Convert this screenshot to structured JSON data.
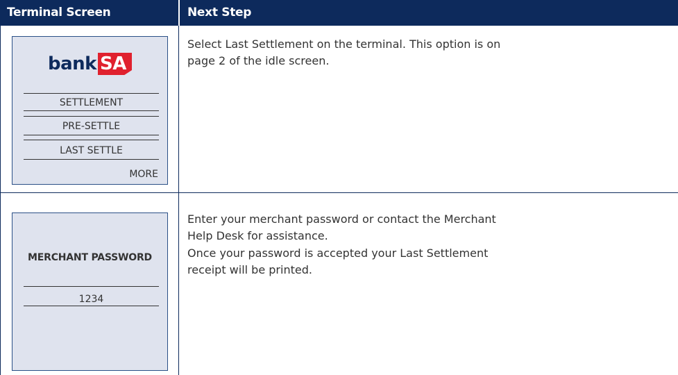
{
  "header": {
    "terminal_screen": "Terminal Screen",
    "next_step": "Next Step"
  },
  "row1": {
    "logo": {
      "bank": "bank",
      "sa": "SA"
    },
    "menu": [
      "SETTLEMENT",
      "PRE-SETTLE",
      "LAST SETTLE"
    ],
    "more": "MORE",
    "step": "Select Last Settlement on the terminal. This option is on page 2 of the idle screen."
  },
  "row2": {
    "title": "MERCHANT PASSWORD",
    "value": "1234",
    "step_1": "Enter your merchant password or contact  the Merchant Help Desk for assistance.",
    "step_2": "Once your password is accepted your Last Settlement receipt will be printed."
  },
  "colors": {
    "header_bg": "#0d2a5c",
    "screen_bg": "#dfe3ee",
    "logo_red": "#e0212e"
  }
}
